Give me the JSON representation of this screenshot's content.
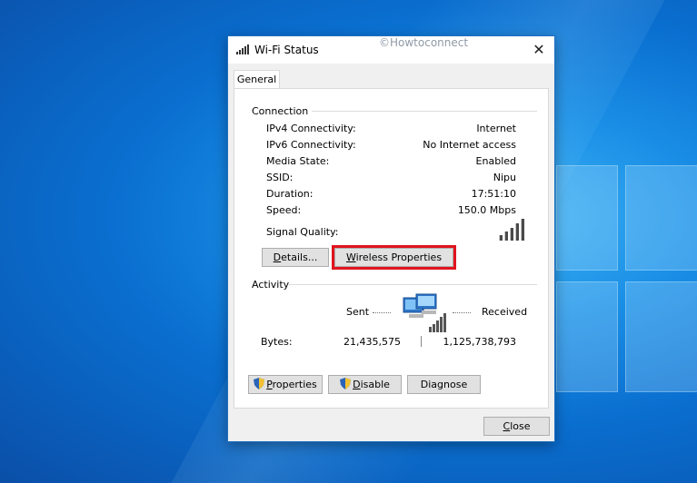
{
  "window": {
    "title": "Wi-Fi Status",
    "watermark": "©Howtoconnect",
    "close_glyph": "✕",
    "tab_label": "General"
  },
  "connection": {
    "heading": "Connection",
    "rows": [
      {
        "label": "IPv4 Connectivity:",
        "value": "Internet"
      },
      {
        "label": "IPv6 Connectivity:",
        "value": "No Internet access"
      },
      {
        "label": "Media State:",
        "value": "Enabled"
      },
      {
        "label": "SSID:",
        "value": "Nipu"
      },
      {
        "label": "Duration:",
        "value": "17:51:10"
      },
      {
        "label": "Speed:",
        "value": "150.0 Mbps"
      }
    ],
    "signal_label": "Signal Quality:",
    "signal_bars": 5,
    "details_button": {
      "underline": "D",
      "rest": "etails..."
    },
    "wireless_button": {
      "underline": "W",
      "rest": "ireless Properties"
    }
  },
  "activity": {
    "heading": "Activity",
    "sent_label": "Sent",
    "received_label": "Received",
    "bytes_label": "Bytes:",
    "bytes_sent": "21,435,575",
    "bytes_received": "1,125,738,793"
  },
  "actions": {
    "properties": {
      "underline": "P",
      "rest": "roperties"
    },
    "disable": {
      "underline": "D",
      "rest": "isable"
    },
    "diagnose": "Diagnose"
  },
  "footer": {
    "close": {
      "underline": "C",
      "rest": "lose"
    }
  },
  "colors": {
    "highlight": "#e0141e",
    "desktop": "#0a6fd0"
  }
}
